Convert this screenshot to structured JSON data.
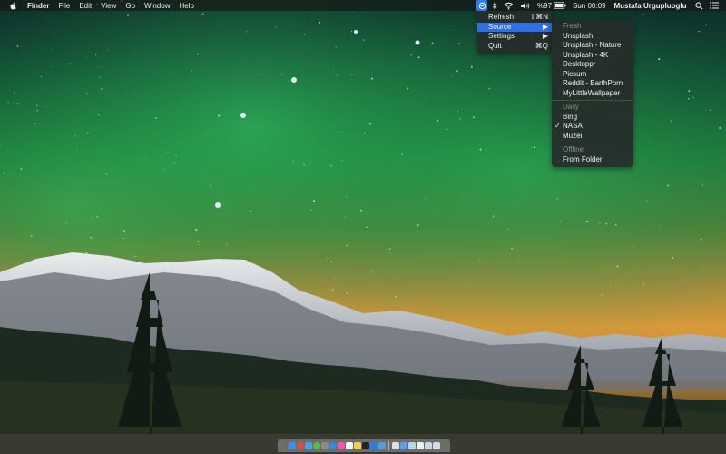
{
  "menubar": {
    "apple_icon": "apple-logo-icon",
    "app_name": "Finder",
    "menus": [
      "File",
      "Edit",
      "View",
      "Go",
      "Window",
      "Help"
    ],
    "status": {
      "app_icon": "wallpaper-app-icon",
      "bluetooth_icon": "bluetooth-icon",
      "wifi_icon": "wifi-icon",
      "volume_icon": "volume-icon",
      "battery_percent": "%97",
      "battery_icon": "battery-icon",
      "clock": "Sun 00:09",
      "user": "Mustafa Urgupluoglu",
      "search_icon": "spotlight-search-icon",
      "list_icon": "notification-center-icon"
    }
  },
  "main_menu": {
    "items": [
      {
        "label": "Refresh",
        "shortcut": "⇧⌘N"
      },
      {
        "label": "Source",
        "shortcut": "▶"
      },
      {
        "label": "Settings",
        "shortcut": "▶"
      },
      {
        "label": "Quit",
        "shortcut": "⌘Q"
      }
    ],
    "highlighted": "Source"
  },
  "source_menu": {
    "fresh_header": "Fresh",
    "fresh_items": [
      "Unsplash",
      "Unsplash - Nature",
      "Unsplash - 4K",
      "Desktoppr",
      "Picsum",
      "Reddit - EarthPorn",
      "MyLittleWallpaper"
    ],
    "daily_header": "Daily",
    "daily_items": [
      "Bing",
      "NASA",
      "Muzei"
    ],
    "checked": "NASA",
    "check_mark": "✓",
    "offline_header": "Offline",
    "offline_items": [
      "From Folder"
    ]
  },
  "colors": {
    "menubar_bg": "#1c2420",
    "highlight": "#2f6fe6",
    "status_app": "#2f7ef3",
    "aurora_green": "#2fbf5a",
    "sky_orange": "#d89a3a"
  },
  "dock": {
    "icons": [
      "finder-icon",
      "chrome-icon",
      "mail-icon",
      "messages-icon",
      "photos-icon",
      "safari-icon",
      "itunes-icon",
      "calendar-icon",
      "notes-icon",
      "terminal-icon",
      "app-store-icon",
      "xcode-icon",
      "preview-icon",
      "folder-icon",
      "mail-attachments-icon",
      "documents-icon",
      "downloads-icon",
      "trash-icon"
    ]
  }
}
